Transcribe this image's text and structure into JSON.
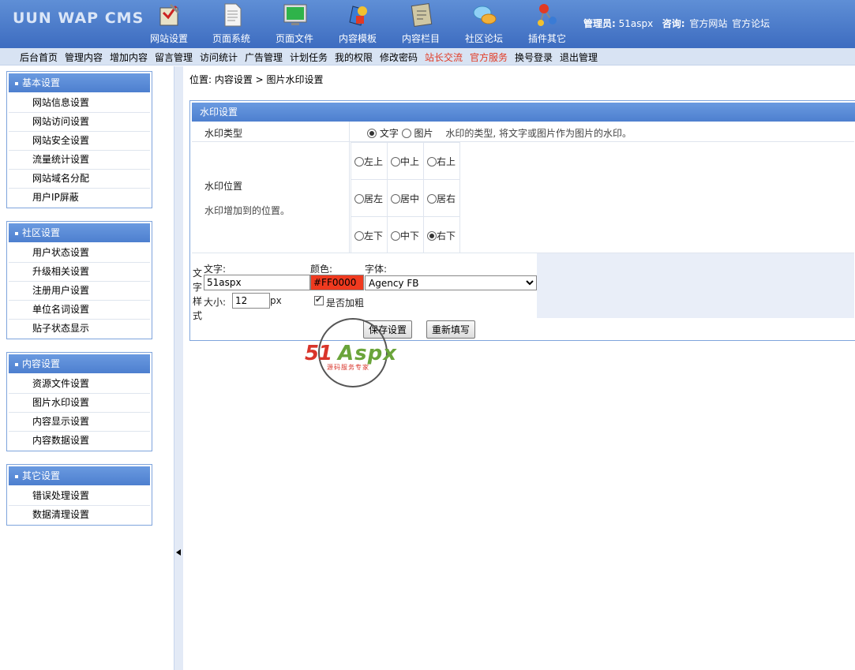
{
  "app": {
    "logo": "UUN WAP CMS"
  },
  "topnav": [
    {
      "label": "网站设置",
      "icon": "website-settings-icon"
    },
    {
      "label": "页面系统",
      "icon": "page-system-icon"
    },
    {
      "label": "页面文件",
      "icon": "page-file-icon"
    },
    {
      "label": "内容模板",
      "icon": "content-template-icon"
    },
    {
      "label": "内容栏目",
      "icon": "content-column-icon"
    },
    {
      "label": "社区论坛",
      "icon": "forum-icon"
    },
    {
      "label": "插件其它",
      "icon": "plugin-icon"
    }
  ],
  "admin": {
    "label": "管理员:",
    "name": "51aspx",
    "consult_label": "咨询:",
    "link1": "官方网站",
    "link2": "官方论坛"
  },
  "submenu": [
    {
      "label": "后台首页",
      "highlight": false
    },
    {
      "label": "管理内容",
      "highlight": false
    },
    {
      "label": "增加内容",
      "highlight": false
    },
    {
      "label": "留言管理",
      "highlight": false
    },
    {
      "label": "访问统计",
      "highlight": false
    },
    {
      "label": "广告管理",
      "highlight": false
    },
    {
      "label": "计划任务",
      "highlight": false
    },
    {
      "label": "我的权限",
      "highlight": false
    },
    {
      "label": "修改密码",
      "highlight": false
    },
    {
      "label": "站长交流",
      "highlight": true
    },
    {
      "label": "官方服务",
      "highlight": true
    },
    {
      "label": "换号登录",
      "highlight": false
    },
    {
      "label": "退出管理",
      "highlight": false
    }
  ],
  "sidebar": {
    "groups": [
      {
        "title": "基本设置",
        "items": [
          "网站信息设置",
          "网站访问设置",
          "网站安全设置",
          "流量统计设置",
          "网站域名分配",
          "用户IP屏蔽"
        ]
      },
      {
        "title": "社区设置",
        "items": [
          "用户状态设置",
          "升级相关设置",
          "注册用户设置",
          "单位名词设置",
          "贴子状态显示"
        ]
      },
      {
        "title": "内容设置",
        "items": [
          "资源文件设置",
          "图片水印设置",
          "内容显示设置",
          "内容数据设置"
        ]
      },
      {
        "title": "其它设置",
        "items": [
          "错误处理设置",
          "数据清理设置"
        ]
      }
    ]
  },
  "breadcrumb": "位置: 内容设置 > 图片水印设置",
  "panel": {
    "title": "水印设置",
    "type_label": "水印类型",
    "type_options": {
      "text": "文字",
      "image": "图片"
    },
    "type_selected": "text",
    "type_hint": "水印的类型, 将文字或图片作为图片的水印。",
    "position_label": "水印位置",
    "position_hint": "水印增加到的位置。",
    "positions": [
      [
        "左上",
        "中上",
        "右上"
      ],
      [
        "居左",
        "居中",
        "居右"
      ],
      [
        "左下",
        "中下",
        "右下"
      ]
    ],
    "position_selected": "右下",
    "style_label": [
      "文",
      "字",
      "样",
      "式"
    ],
    "text_label": "文字:",
    "text_value": "51aspx",
    "color_label": "颜色:",
    "color_value": "#FF0000",
    "font_label": "字体:",
    "font_value": "Agency FB",
    "size_label": "大小:",
    "size_value": "12",
    "size_unit": "px",
    "bold_label": "是否加粗",
    "bold_checked": true,
    "save_label": "保存设置",
    "reset_label": "重新填写"
  },
  "watermark": {
    "brand": "51Aspx",
    "brand_a": "51",
    "brand_b": "Aspx",
    "slogan": "源码服务专家"
  },
  "colors": {
    "header": "#4a79c8",
    "accent_red": "#e23a24",
    "input_red": "#ef3a1f"
  }
}
